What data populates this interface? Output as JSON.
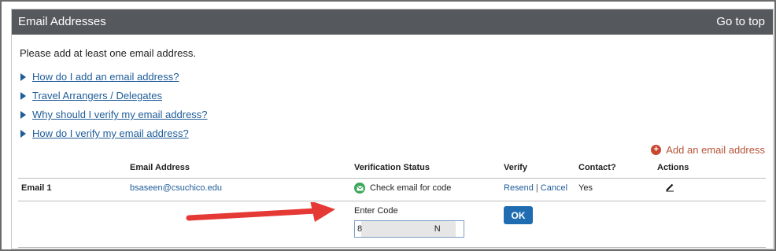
{
  "panel": {
    "title": "Email Addresses",
    "goto_top": "Go to top"
  },
  "intro": "Please add at least one email address.",
  "help_links": [
    "How do I add an email address?",
    "Travel Arrangers / Delegates",
    "Why should I verify my email address?",
    "How do I verify my email address?"
  ],
  "add_email": {
    "label": "Add an email address",
    "icon": "plus-circle-icon"
  },
  "table": {
    "headers": {
      "email": "Email Address",
      "status": "Verification Status",
      "verify": "Verify",
      "contact": "Contact?",
      "actions": "Actions"
    },
    "row": {
      "label": "Email 1",
      "email": "bsaseen@csuchico.edu",
      "status": "Check email for code",
      "status_icon": "envelope-icon",
      "resend": "Resend",
      "separator": "|",
      "cancel": "Cancel",
      "contact": "Yes",
      "action_icon": "pencil-icon"
    }
  },
  "verify_form": {
    "label": "Enter Code",
    "value": "8                              N",
    "ok": "OK"
  },
  "colors": {
    "header_bg": "#55595d",
    "link": "#1f5c99",
    "add_accent": "#c8472f",
    "arrow": "#e53935",
    "ok_bg": "#1f6db0",
    "status_icon": "#3aa657"
  }
}
